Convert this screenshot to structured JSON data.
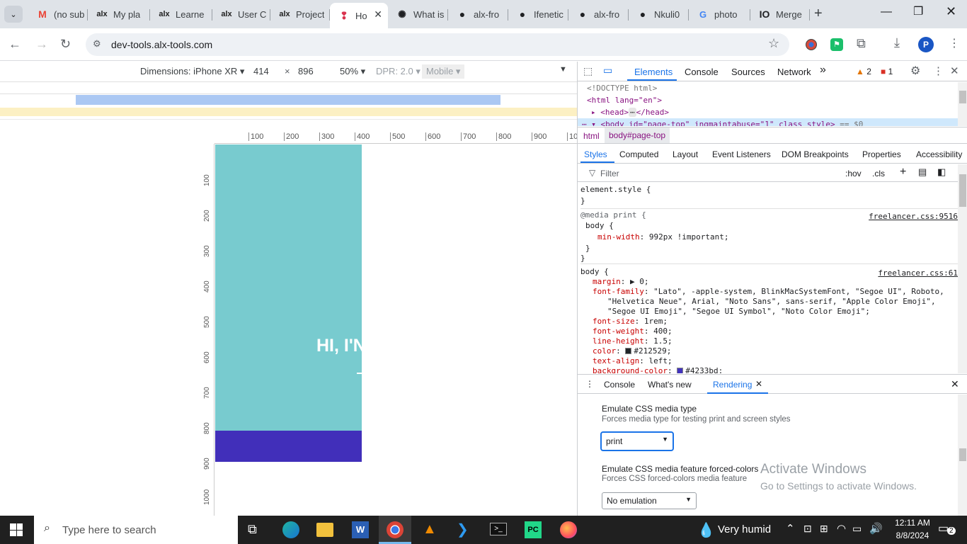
{
  "tabs": [
    {
      "label": "(no sub",
      "icon": "gmail-icon",
      "active": false
    },
    {
      "label": "My pla",
      "icon": "alx-icon",
      "active": false
    },
    {
      "label": "Learne",
      "icon": "alx-icon",
      "active": false
    },
    {
      "label": "User C",
      "icon": "alx-icon",
      "active": false
    },
    {
      "label": "Project",
      "icon": "alx-icon",
      "active": false
    },
    {
      "label": "Ho",
      "icon": "alx-devtools-icon",
      "active": true
    },
    {
      "label": "What is",
      "icon": "openai-icon",
      "active": false
    },
    {
      "label": "alx-fro",
      "icon": "github-icon",
      "active": false
    },
    {
      "label": "Ifenetic",
      "icon": "github-icon",
      "active": false
    },
    {
      "label": "alx-fro",
      "icon": "github-icon",
      "active": false
    },
    {
      "label": "Nkuli0",
      "icon": "github-icon",
      "active": false
    },
    {
      "label": "photo",
      "icon": "google-icon",
      "active": false
    },
    {
      "label": "Merge",
      "icon": "ilovepdf-icon",
      "active": false
    }
  ],
  "url": "dev-tools.alx-tools.com",
  "device": {
    "dimensions_label": "Dimensions: iPhone XR",
    "width": "414",
    "x": "×",
    "height": "896",
    "zoom": "50%",
    "dpr": "DPR: 2.0",
    "mode": "Mobile"
  },
  "ruler_h": [
    "100",
    "200",
    "300",
    "400",
    "500",
    "600",
    "700",
    "800",
    "900",
    "10"
  ],
  "ruler_v": [
    "100",
    "200",
    "300",
    "400",
    "500",
    "600",
    "700",
    "800",
    "900",
    "1000"
  ],
  "page": {
    "hero_text": "HI, I'N"
  },
  "devtools": {
    "tabs": [
      "Elements",
      "Console",
      "Sources",
      "Network"
    ],
    "more": "»",
    "warnings": "2",
    "errors": "1",
    "dom_lines": [
      "<!DOCTYPE html>",
      "<html lang=\"en\">",
      "<head>",
      "</head>",
      "<body id=\"page-top\" ingmaintabuse=\"1\" class style>",
      "== $0"
    ],
    "breadcrumb": [
      "html",
      "body#page-top"
    ],
    "subtabs": [
      "Styles",
      "Computed",
      "Layout",
      "Event Listeners",
      "DOM Breakpoints",
      "Properties",
      "Accessibility"
    ],
    "filter_placeholder": "Filter",
    "hov": ":hov",
    "cls": ".cls",
    "rules": {
      "element_style": "element.style {",
      "close": "}",
      "media": "@media print {",
      "media_src": "freelancer.css:9516",
      "media_sel": "body {",
      "media_prop": "min-width",
      "media_val": "992px !important;",
      "body_sel": "body {",
      "body_src": "freelancer.css:61",
      "props": [
        {
          "p": "margin",
          "v": "▶ 0;"
        },
        {
          "p": "font-family",
          "v": "\"Lato\", -apple-system, BlinkMacSystemFont, \"Segoe UI\", Roboto,"
        },
        {
          "p": "",
          "v": "\"Helvetica Neue\", Arial, \"Noto Sans\", sans-serif, \"Apple Color Emoji\","
        },
        {
          "p": "",
          "v": "\"Segoe UI Emoji\", \"Segoe UI Symbol\", \"Noto Color Emoji\";"
        },
        {
          "p": "font-size",
          "v": "1rem;"
        },
        {
          "p": "font-weight",
          "v": "400;"
        },
        {
          "p": "line-height",
          "v": "1.5;"
        },
        {
          "p": "color",
          "v": "#212529;"
        },
        {
          "p": "text-align",
          "v": "left;"
        },
        {
          "p": "background-color",
          "v": "#4233bd;"
        }
      ]
    },
    "drawer_tabs": [
      "Console",
      "What's new",
      "Rendering"
    ],
    "rendering": {
      "media_title": "Emulate CSS media type",
      "media_desc": "Forces media type for testing print and screen styles",
      "media_value": "print",
      "fc_title": "Emulate CSS media feature forced-colors",
      "fc_desc": "Forces CSS forced-colors media feature",
      "fc_value": "No emulation"
    }
  },
  "watermark": {
    "title": "Activate Windows",
    "sub": "Go to Settings to activate Windows."
  },
  "taskbar": {
    "search": "Type here to search",
    "weather": "Very humid",
    "time": "12:11 AM",
    "date": "8/8/2024",
    "notif": "2"
  },
  "colors": {
    "teal": "#78cbcf",
    "indigo": "#412fba",
    "devtools_blue": "#1a73e8"
  }
}
